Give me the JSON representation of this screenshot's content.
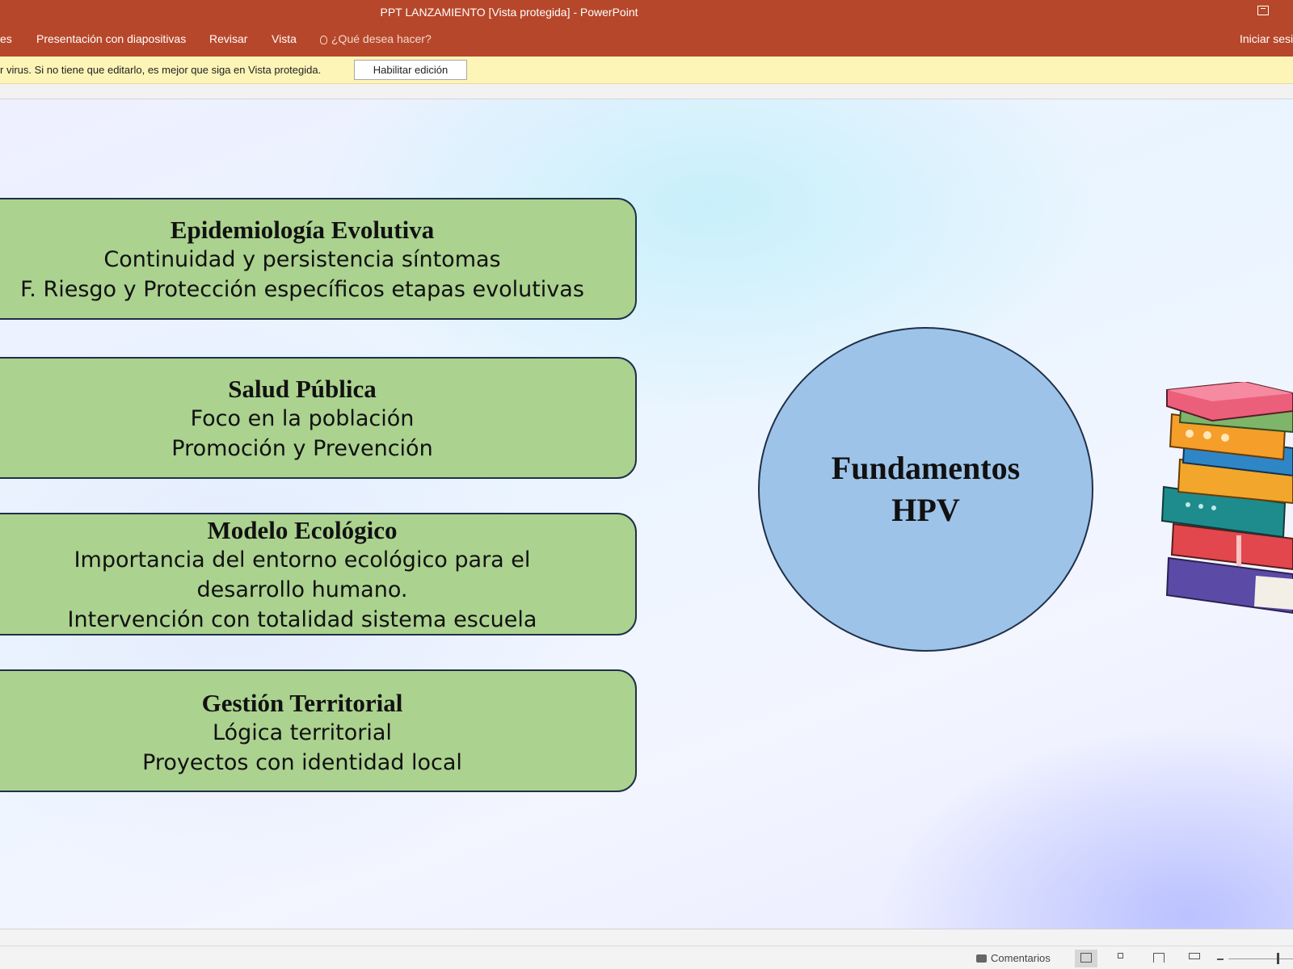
{
  "window": {
    "title": "PPT LANZAMIENTO [Vista protegida] - PowerPoint"
  },
  "ribbon": {
    "tabs": [
      {
        "label": "es"
      },
      {
        "label": "Presentación con diapositivas"
      },
      {
        "label": "Revisar"
      },
      {
        "label": "Vista"
      }
    ],
    "tell_me": "¿Qué desea hacer?",
    "sign_in": "Iniciar sesi"
  },
  "message_bar": {
    "text": "r virus. Si no tiene que editarlo, es mejor que siga en Vista protegida.",
    "enable_button": "Habilitar edición"
  },
  "slide": {
    "boxes": [
      {
        "title": "Epidemiología Evolutiva",
        "lines": [
          "Continuidad y persistencia síntomas",
          "F. Riesgo y Protección específicos etapas evolutivas"
        ]
      },
      {
        "title": "Salud Pública",
        "lines": [
          "Foco en la población",
          "Promoción y Prevención"
        ]
      },
      {
        "title": "Modelo Ecológico",
        "lines": [
          "Importancia del entorno ecológico para el",
          "desarrollo humano.",
          "Intervención con totalidad sistema escuela"
        ]
      },
      {
        "title": "Gestión Territorial",
        "lines": [
          "Lógica territorial",
          "Proyectos con identidad local"
        ]
      }
    ],
    "circle": {
      "line1": "Fundamentos",
      "line2": "HPV"
    },
    "colors": {
      "box_fill": "#abd28f",
      "circle_fill": "#9dc3e8",
      "outline": "#203049"
    }
  },
  "status_bar": {
    "comments": "Comentarios"
  },
  "colors": {
    "title_bar": "#b7472a",
    "message_bar": "#fdf5b7"
  },
  "icons": [
    "lightbulb-icon",
    "restore-window-icon",
    "comment-icon",
    "normal-view-icon",
    "slide-sorter-icon",
    "reading-view-icon",
    "slideshow-icon",
    "books-illustration"
  ]
}
